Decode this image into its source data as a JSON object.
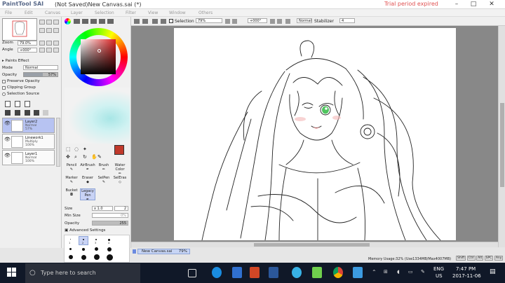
{
  "app": {
    "logo": "PaintTool SAI",
    "title": "(Not Saved)New Canvas.sai (*)",
    "trial": "Trial period expired"
  },
  "window_buttons": [
    "–",
    "□",
    "✕"
  ],
  "menu": [
    "File",
    "Edit",
    "Canvas",
    "Layer",
    "Selection",
    "Filter",
    "View",
    "Window",
    "Others"
  ],
  "navigator": {
    "zoom_label": "Zoom",
    "zoom_value": "79.0%",
    "angle_label": "Angle",
    "angle_value": "+000°"
  },
  "layer_panel": {
    "paints_effect": "Paints Effect",
    "mode_label": "Mode",
    "mode_value": "Normal",
    "opacity_label": "Opacity",
    "opacity_value": "57%",
    "preserve_opacity": "Preserve Opacity",
    "clipping_group": "Clipping Group",
    "selection_source": "Selection Source",
    "layers": [
      {
        "name": "Layer2",
        "mode": "Normal",
        "opacity": "57%"
      },
      {
        "name": "Linework1",
        "mode": "Multiply",
        "opacity": "100%"
      },
      {
        "name": "Layer1",
        "mode": "Normal",
        "opacity": "100%"
      }
    ]
  },
  "toolbar": {
    "selection_label": "Selection",
    "zoom_value": "79%",
    "angle_value": "+000°",
    "mode_value": "Normal",
    "stabilizer_label": "Stabilizer",
    "stabilizer_value": "4"
  },
  "tools": [
    {
      "name": "Pencil"
    },
    {
      "name": "AirBrush"
    },
    {
      "name": "Brush"
    },
    {
      "name": "Water Color"
    },
    {
      "name": "Marker"
    },
    {
      "name": "Eraser"
    },
    {
      "name": "SelPen"
    },
    {
      "name": "SelEras"
    },
    {
      "name": "Bucket"
    },
    {
      "name": "Legacy Pen"
    }
  ],
  "brush": {
    "size_label": "Size",
    "size_mult": "x 1.0",
    "size_value": "2",
    "min_size_label": "Min Size",
    "min_size_value": "0%",
    "opacity_label": "Opacity",
    "opacity_value": "255",
    "advanced": "Advanced Settings",
    "sizes_row1": [
      "1",
      "2",
      "3",
      "4"
    ]
  },
  "status": {
    "tab_label": "New Canvas.sai",
    "tab_zoom": "79%",
    "memory": "Memory Usage:32% (Use1334MB/Max4007MB)",
    "indicators": [
      "Shift",
      "Ctrl",
      "Alt",
      "SPC",
      "Any"
    ]
  },
  "taskbar": {
    "search_placeholder": "Type here to search",
    "lang": "ENG",
    "region": "US",
    "time": "7:47 PM",
    "date": "2017-11-06"
  },
  "colors": {
    "current": "#c0392b",
    "accent_trial": "#e05050",
    "layer_selected": "#b7c3f2"
  }
}
